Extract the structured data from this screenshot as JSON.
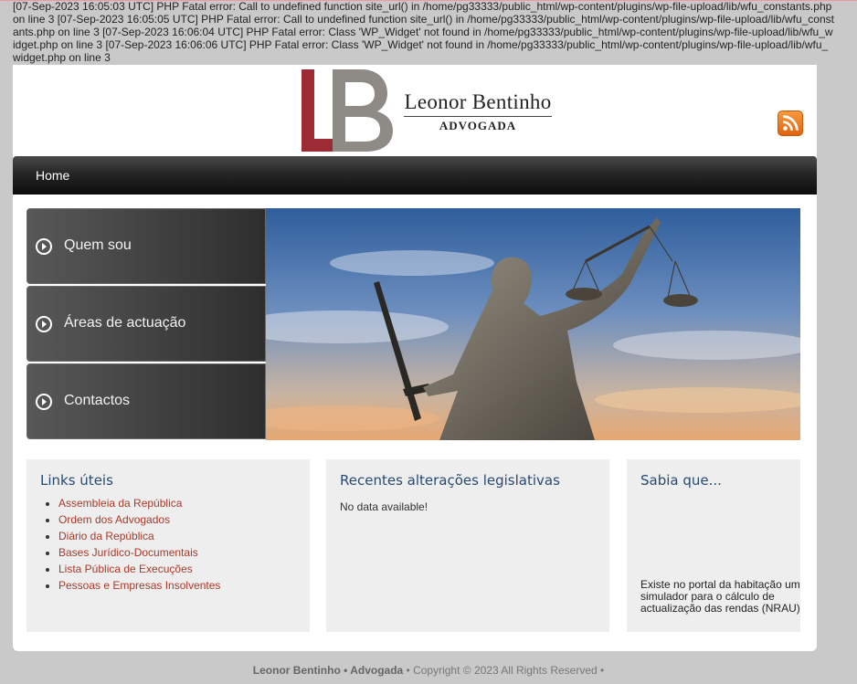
{
  "errors": [
    "[07-Sep-2023 16:05:03 UTC] PHP Fatal error: Call to undefined function site_url() in /home/pg33333/public_html/wp-content/plugins/wp-file-upload/lib/wfu_constants.php on line 3",
    "[07-Sep-2023 16:05:05 UTC] PHP Fatal error: Call to undefined function site_url() in /home/pg33333/public_html/wp-content/plugins/wp-file-upload/lib/wfu_constants.php on line 3",
    "[07-Sep-2023 16:06:04 UTC] PHP Fatal error: Class 'WP_Widget' not found in /home/pg33333/public_html/wp-content/plugins/wp-file-upload/lib/wfu_widget.php on line 3",
    "[07-Sep-2023 16:06:06 UTC] PHP Fatal error: Class 'WP_Widget' not found in /home/pg33333/public_html/wp-content/plugins/wp-file-upload/lib/wfu_widget.php on line 3"
  ],
  "logo": {
    "name": "Leonor Bentinho",
    "subtitle": "ADVOGADA",
    "monogram": "LB"
  },
  "nav": {
    "home": "Home"
  },
  "side_menu": [
    "Quem sou",
    "Áreas de actuação",
    "Contactos"
  ],
  "links_box": {
    "title": "Links úteis",
    "items": [
      "Assembleia da República",
      "Ordem dos Advogados",
      "Diário da República",
      "Bases Jurídico-Documentais",
      "Lista Pública de Execuções",
      "Pessoas e Empresas Insolventes"
    ]
  },
  "legis_box": {
    "title": "Recentes alterações legislativas",
    "empty": "No data available!"
  },
  "sabia_box": {
    "title": "Sabia que...",
    "text": "Existe no portal da habitação um simulador para o cálculo de actualização das rendas (NRAU)"
  },
  "footer": {
    "brand": "Leonor Bentinho • Advogada",
    "copy": " • Copyright © 2023 All Rights Reserved •"
  },
  "colors": {
    "link": "#a83a2a",
    "heading": "#274a73",
    "logo_red": "#9c2b35",
    "logo_grey": "#8e8a86",
    "rss": "#f08a24"
  },
  "icons": {
    "rss": "rss-feed-icon",
    "menu_arrow": "circle-chevron-right-icon"
  }
}
